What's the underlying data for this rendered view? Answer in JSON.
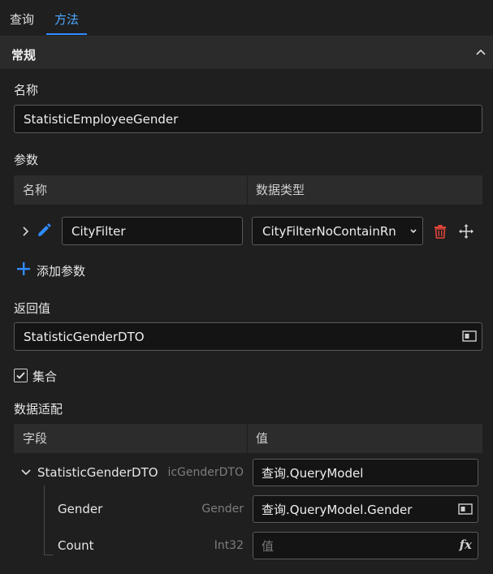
{
  "tabs": [
    {
      "label": "查询",
      "active": false
    },
    {
      "label": "方法",
      "active": true
    }
  ],
  "section": {
    "title": "常规",
    "collapse_icon": "chevron-up-icon"
  },
  "name": {
    "label": "名称",
    "value": "StatisticEmployeeGender"
  },
  "params": {
    "label": "参数",
    "columns": [
      "名称",
      "数据类型"
    ],
    "rows": [
      {
        "name": "CityFilter",
        "type": "CityFilterNoContainRn"
      }
    ],
    "add_label": "添加参数"
  },
  "return_value": {
    "label": "返回值",
    "value": "StatisticGenderDTO"
  },
  "collection": {
    "label": "集合",
    "checked": true
  },
  "mapping": {
    "label": "数据适配",
    "columns": [
      "字段",
      "值"
    ],
    "rows": [
      {
        "field": "StatisticGenderDTO",
        "type": "icGenderDTO",
        "value": "查询.QueryModel",
        "placeholder": ""
      },
      {
        "field": "Gender",
        "type": "Gender",
        "value": "查询.QueryModel.Gender",
        "placeholder": ""
      },
      {
        "field": "Count",
        "type": "Int32",
        "value": "",
        "placeholder": "值"
      }
    ]
  },
  "colors": {
    "accent": "#2f8cff",
    "delete": "#e0453a",
    "background": "#1f1f1f"
  }
}
